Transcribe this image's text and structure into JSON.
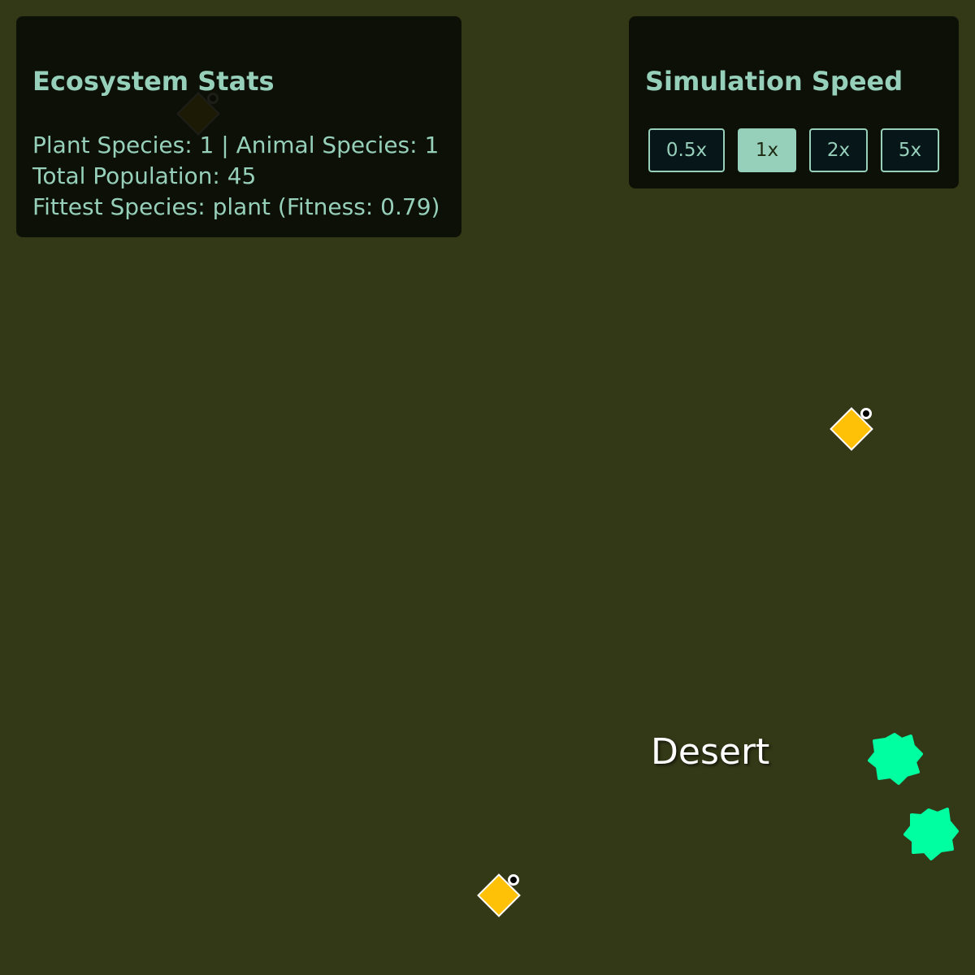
{
  "stats_panel": {
    "title": "Ecosystem Stats",
    "lines": [
      "Plant Species: 1 | Animal Species: 1",
      "Total Population: 45",
      "Fittest Species: plant (Fitness: 0.79)"
    ]
  },
  "speed_panel": {
    "title": "Simulation Speed",
    "buttons": [
      "0.5x",
      "1x",
      "2x",
      "5x"
    ],
    "selected": "1x"
  },
  "world": {
    "biome_label": "Desert",
    "background_color": "#333817",
    "animal_color": "#ffc107",
    "plant_color": "#00ffa0",
    "animal_icon": "animal-diamond-icon",
    "plant_icon": "plant-blob-icon"
  },
  "colors": {
    "panel_text": "#96d0bb",
    "panel_bg": "#0b0d05",
    "button_bg": "#071618"
  }
}
